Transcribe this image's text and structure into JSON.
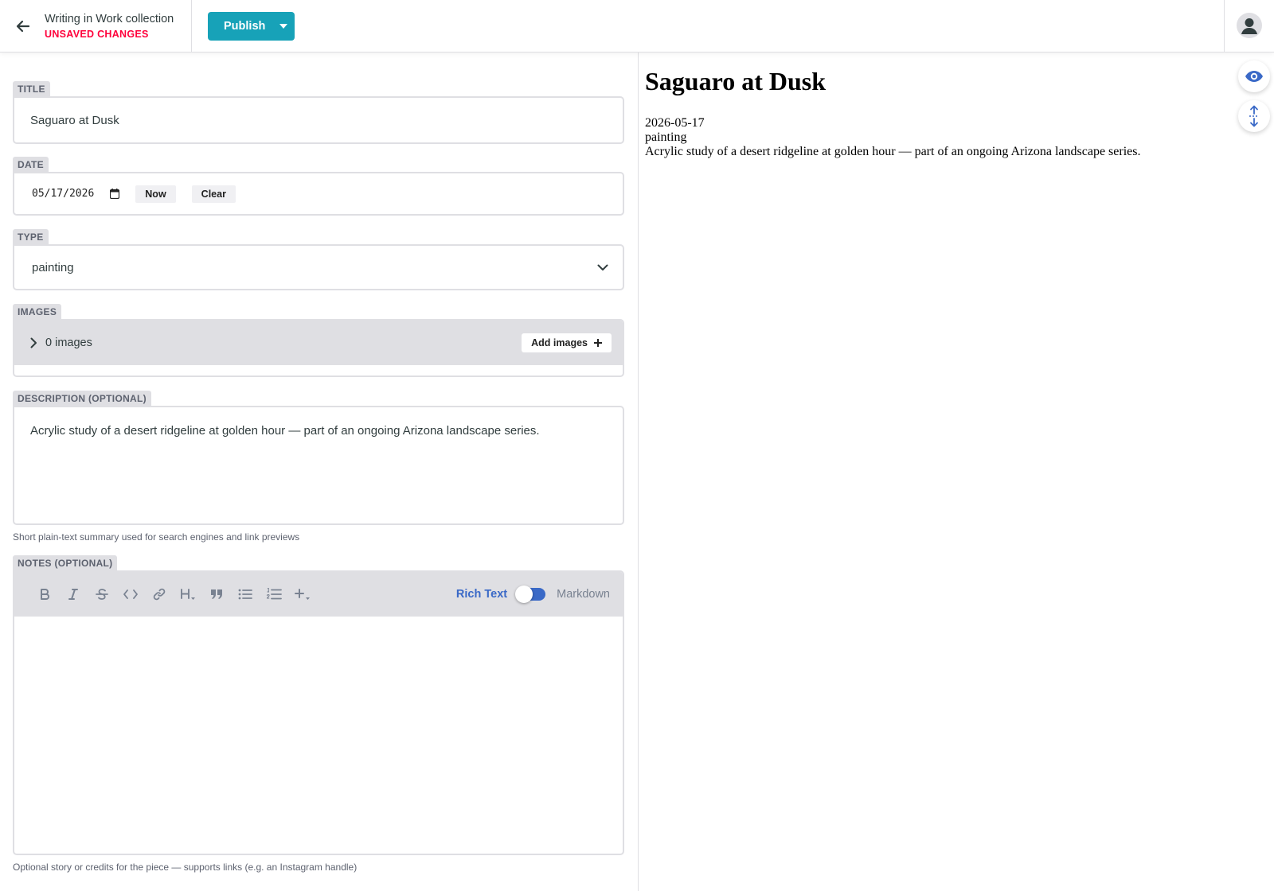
{
  "header": {
    "collection_title": "Writing in Work collection",
    "status": "UNSAVED CHANGES",
    "publish_label": "Publish"
  },
  "fields": {
    "title": {
      "label": "TITLE",
      "value": "Saguaro at Dusk"
    },
    "date": {
      "label": "DATE",
      "value": "05/17/2026",
      "now_label": "Now",
      "clear_label": "Clear"
    },
    "type": {
      "label": "TYPE",
      "value": "painting"
    },
    "images": {
      "label": "IMAGES",
      "count_text": "0 images",
      "add_label": "Add images"
    },
    "description": {
      "label": "DESCRIPTION (OPTIONAL)",
      "value": "Acrylic study of a desert ridgeline at golden hour — part of an ongoing Arizona landscape series.",
      "hint": "Short plain-text summary used for search engines and link previews"
    },
    "notes": {
      "label": "NOTES (OPTIONAL)",
      "rich_text_label": "Rich Text",
      "markdown_label": "Markdown",
      "mode": "rich-text",
      "value": "",
      "hint": "Optional story or credits for the piece — supports links (e.g. an Instagram handle)",
      "toolbar": [
        "bold-icon",
        "italic-icon",
        "strikethrough-icon",
        "code-icon",
        "link-icon",
        "heading-icon",
        "quote-icon",
        "bulleted-list-icon",
        "numbered-list-icon",
        "add-component-icon"
      ]
    }
  },
  "preview": {
    "title": "Saguaro at Dusk",
    "date": "2026-05-17",
    "type": "painting",
    "description": "Acrylic study of a desert ridgeline at golden hour — part of an ongoing Arizona landscape series."
  },
  "colors": {
    "accent": "#17a2b8",
    "warning": "#ff003b",
    "link_blue": "#3a69c7",
    "field_border": "#dfdfe3"
  }
}
